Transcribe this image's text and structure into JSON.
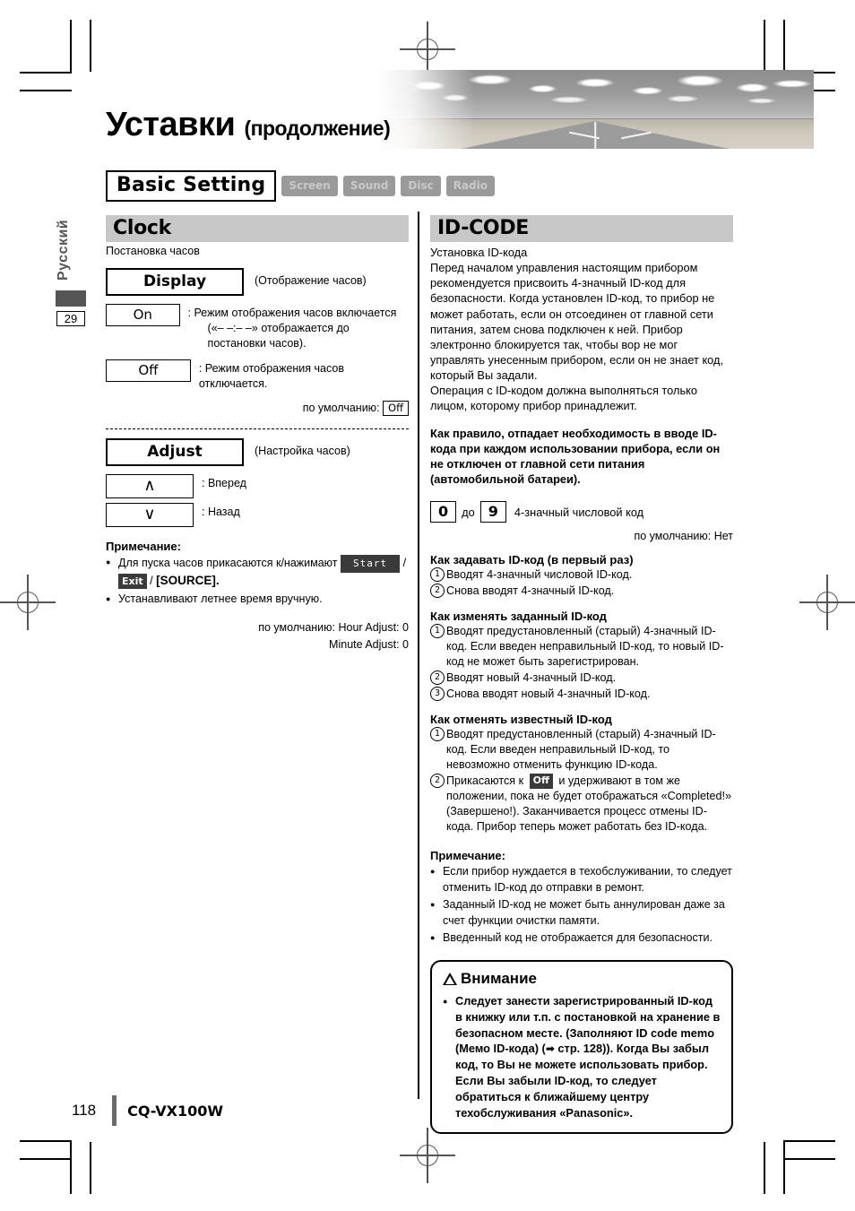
{
  "page": {
    "title_main": "Уставки",
    "title_sub": "(продолжение)",
    "page_number_footer": "118",
    "model": "CQ-VX100W",
    "thumb_language": "Русский",
    "thumb_page": "29"
  },
  "basic_setting": {
    "label": "Basic Setting",
    "tabs": [
      "Screen",
      "Sound",
      "Disc",
      "Radio"
    ]
  },
  "clock": {
    "heading": "Clock",
    "subheading": "Постановка часов",
    "display": {
      "label": "Display",
      "caption": "(Отображение часов)",
      "options": [
        {
          "label": "On",
          "desc_line1": ": Режим отображения часов включается",
          "desc_line2": "(«– –:– –» отображается до постановки часов)."
        },
        {
          "label": "Off",
          "desc_line1": ": Режим отображения часов отключается.",
          "desc_line2": ""
        }
      ],
      "default_prefix": "по умолчанию:",
      "default_value": "Off"
    },
    "adjust": {
      "label": "Adjust",
      "caption": "(Настройка часов)",
      "options": [
        {
          "glyph": "∧",
          "desc": ": Вперед"
        },
        {
          "glyph": "∨",
          "desc": ": Назад"
        }
      ]
    },
    "note": {
      "title": "Примечание:",
      "item1_pre": "Для пуска часов прикасаются к/нажимают",
      "item1_key_start": "Start",
      "item1_sep": "/",
      "item1_key_exit": "Exit",
      "item1_sep2": "/",
      "item1_source": "[SOURCE].",
      "item2": "Устанавливают летнее время вручную."
    },
    "defaults": {
      "line1": "по умолчанию: Hour Adjust: 0",
      "line2": "Minute Adjust: 0"
    }
  },
  "id_code": {
    "heading": "ID-CODE",
    "subheading": "Установка ID-кода",
    "intro": "Перед началом управления настоящим прибором рекомендуется присвоить 4-значный ID-код для безопасности. Когда установлен ID-код, то прибор не может работать, если он отсоединен от главной сети питания, затем снова подключен к ней. Прибор электронно блокируется так, чтобы вор не мог управлять унесенным прибором, если он не знает код, который Вы задали.",
    "intro2": "Операция с ID-кодом должна выполняться только лицом, которому прибор принадлежит.",
    "bold_note": "Как правило, отпадает необходимость в вводе ID-кода при каждом использовании прибора, если он не отключен от главной сети питания (автомобильной батареи).",
    "range": {
      "from": "0",
      "between": "до",
      "to": "9",
      "desc": "4-значный числовой код"
    },
    "default_line": "по умолчанию: Нет",
    "sections": [
      {
        "title": "Как задавать ID-код (в первый раз)",
        "steps": [
          {
            "n": "1",
            "text": "Вводят 4-значный числовой ID-код."
          },
          {
            "n": "2",
            "text": "Снова вводят 4-значный ID-код."
          }
        ]
      },
      {
        "title": "Как изменять заданный ID-код",
        "steps": [
          {
            "n": "1",
            "text": "Вводят предустановленный (старый) 4-значный ID-код. Если введен неправильный ID-код, то новый ID-код не может быть зарегистрирован."
          },
          {
            "n": "2",
            "text": "Вводят новый 4-значный ID-код."
          },
          {
            "n": "3",
            "text": "Снова вводят новый 4-значный ID-код."
          }
        ]
      }
    ],
    "cancel_section": {
      "title": "Как отменять известный ID-код",
      "step1_n": "1",
      "step1_text": "Вводят предустановленный (старый) 4-значный ID-код. Если введен неправильный ID-код, то невозможно отменить функцию ID-кода.",
      "step2_n": "2",
      "step2_pre": "Прикасаются к",
      "step2_key": "Off",
      "step2_post": "и удерживают в том же положении, пока не будет отображаться «Completed!» (Завершено!). Заканчивается процесс отмены ID-кода. Прибор теперь может работать без ID-кода."
    },
    "note": {
      "title": "Примечание:",
      "items": [
        "Если прибор нуждается в техобслуживании, то следует отменить ID-код до отправки в ремонт.",
        "Заданный ID-код не может быть аннулирован даже за счет функции очистки памяти.",
        "Введенный код не отображается для безопасности."
      ]
    },
    "caution": {
      "title": "Внимание",
      "text_pre": "Следует занести зарегистрированный ID-код в книжку или т.п. с постановкой на хранение в безопасном месте. (Заполняют ID code memo (Мемо ID-кода) (",
      "arrow": "➡",
      "text_post": " стр. 128)). Когда Вы забыл код, то Вы не можете использовать прибор. Если Вы забыли ID-код, то следует обратиться к ближайшему центру техобслуживания «Panasonic»."
    }
  },
  "colors": {
    "section_header_bg": "#c7c7c7",
    "tab_chip_bg": "#9a9a9a",
    "keycap_bg": "#3a3a3a",
    "thumb_bar": "#555555"
  }
}
